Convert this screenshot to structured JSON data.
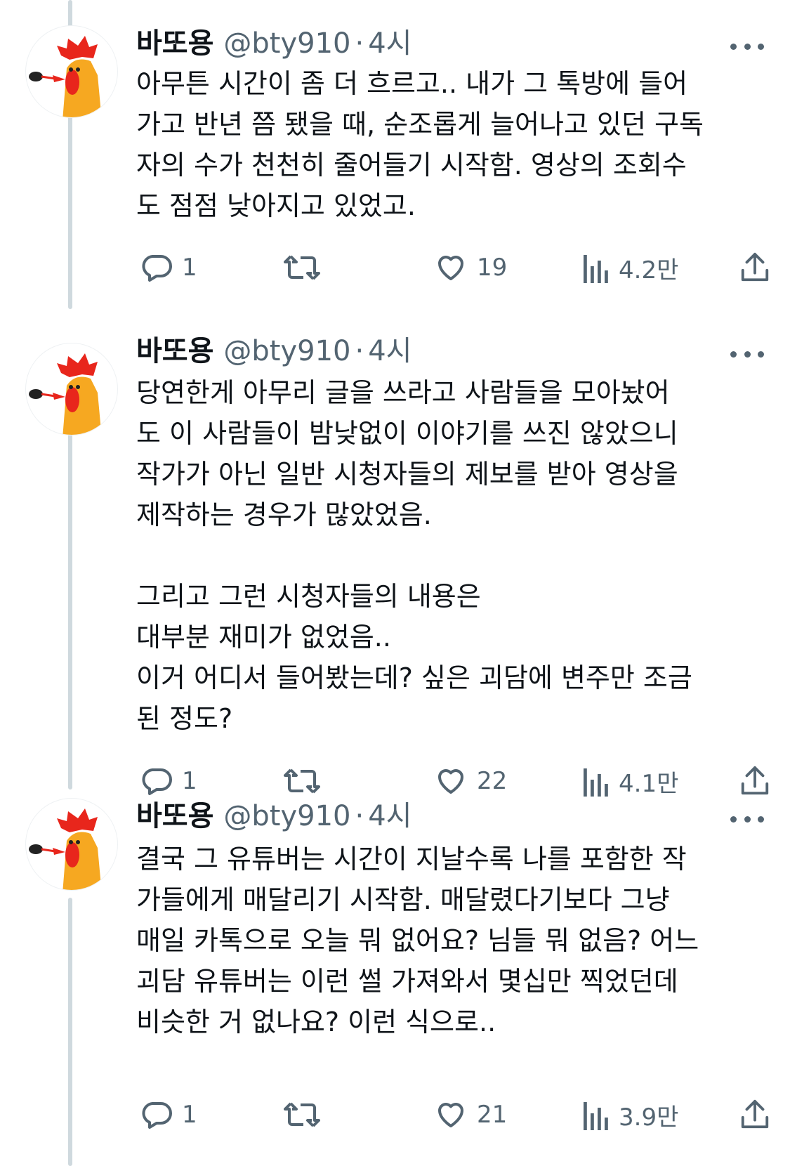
{
  "tweets": [
    {
      "name": "바또용",
      "handle": "@bty910",
      "separator": "·",
      "time": "4시",
      "lines": [
        "아무튼 시간이 좀 더 흐르고.. 내가 그 톡방에 들어",
        "가고 반년 쯤 됐을 때, 순조롭게 늘어나고 있던 구독",
        "자의 수가 천천히 줄어들기 시작함. 영상의 조회수",
        "도 점점 낮아지고 있었고."
      ],
      "reply_count": "1",
      "retweet_count": "",
      "like_count": "19",
      "view_count": "4.2만"
    },
    {
      "name": "바또용",
      "handle": "@bty910",
      "separator": "·",
      "time": "4시",
      "lines": [
        "당연한게  아무리 글을 쓰라고 사람들을 모아놨어",
        "도 이 사람들이 밤낮없이 이야기를 쓰진 않았으니",
        "작가가 아닌 일반 시청자들의 제보를 받아 영상을",
        "제작하는 경우가 많았었음.",
        "",
        "그리고 그런 시청자들의 내용은",
        "대부분 재미가 없었음..",
        "이거 어디서 들어봤는데? 싶은 괴담에 변주만 조금",
        "된 정도?"
      ],
      "reply_count": "1",
      "retweet_count": "",
      "like_count": "22",
      "view_count": "4.1만"
    },
    {
      "name": "바또용",
      "handle": "@bty910",
      "separator": "·",
      "time": "4시",
      "lines": [
        "결국 그 유튜버는 시간이 지날수록 나를 포함한 작",
        "가들에게 매달리기 시작함. 매달렸다기보다 그냥",
        "매일 카톡으로 오늘 뭐 없어요? 님들 뭐 없음? 어느",
        "괴담 유튜버는 이런 썰 가져와서 몇십만 찍었던데",
        "비슷한 거 없나요? 이런 식으로.."
      ],
      "reply_count": "1",
      "retweet_count": "",
      "like_count": "21",
      "view_count": "3.9만"
    }
  ],
  "icons": {
    "reply": "reply-icon",
    "retweet": "retweet-icon",
    "like": "heart-icon",
    "views": "views-icon",
    "share": "share-icon",
    "more": "more-icon"
  },
  "colors": {
    "text": "#0f1419",
    "secondary": "#536471",
    "thread_line": "#cfd9de",
    "avatar_orange": "#f6a821",
    "avatar_red": "#e8261c"
  }
}
